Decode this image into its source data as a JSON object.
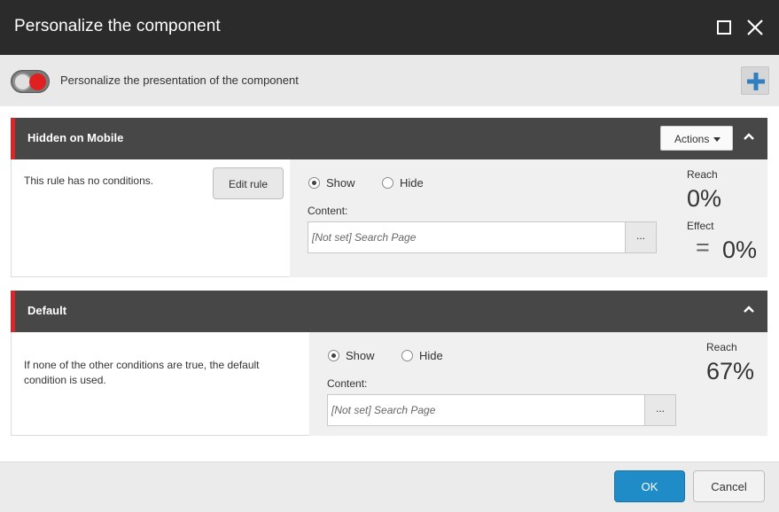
{
  "dialog": {
    "title": "Personalize the component",
    "maximize_icon": "maximize-icon",
    "close_icon": "close-icon"
  },
  "toolbar": {
    "toggle_state": "off",
    "label": "Personalize the presentation of the component",
    "add_icon": "plus-icon",
    "add_icon_color": "#2f7fc1"
  },
  "rules": [
    {
      "title": "Hidden on Mobile",
      "actions_label": "Actions",
      "description": "This rule has no conditions.",
      "edit_label": "Edit rule",
      "show_label": "Show",
      "hide_label": "Hide",
      "selected": "Show",
      "content_label": "Content:",
      "content_value": "[Not set] Search Page",
      "browse_label": "...",
      "reach_label": "Reach",
      "reach_value": "0%",
      "effect_label": "Effect",
      "effect_symbol": "=",
      "effect_value": "0%"
    },
    {
      "title": "Default",
      "description": "If none of the other conditions are true, the default condition is used.",
      "show_label": "Show",
      "hide_label": "Hide",
      "selected": "Show",
      "content_label": "Content:",
      "content_value": "[Not set] Search Page",
      "browse_label": "...",
      "reach_label": "Reach",
      "reach_value": "67%"
    }
  ],
  "footer": {
    "ok_label": "OK",
    "cancel_label": "Cancel"
  },
  "colors": {
    "titlebar": "#2b2b2b",
    "rule_header": "#474747",
    "rule_accent": "#d9262b",
    "primary_button": "#1f8cc8"
  }
}
